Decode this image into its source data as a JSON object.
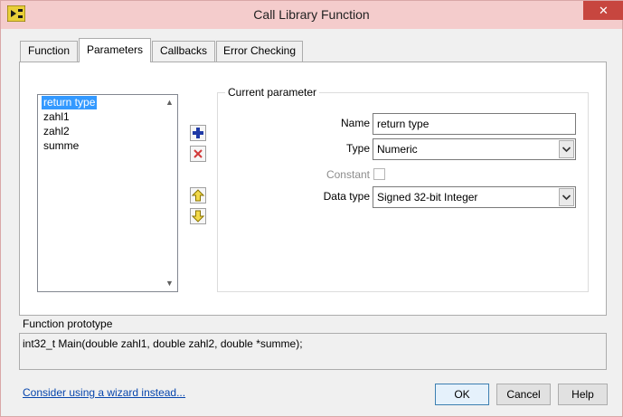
{
  "window": {
    "title": "Call Library Function",
    "close_label": "✕"
  },
  "tabs": [
    {
      "label": "Function",
      "active": false
    },
    {
      "label": "Parameters",
      "active": true
    },
    {
      "label": "Callbacks",
      "active": false
    },
    {
      "label": "Error Checking",
      "active": false
    }
  ],
  "parameters": {
    "list": [
      "return type",
      "zahl1",
      "zahl2",
      "summe"
    ],
    "selected_index": 0,
    "side_buttons": [
      "add-icon",
      "delete-icon",
      "move-up-icon",
      "move-down-icon"
    ]
  },
  "current_parameter": {
    "group_title": "Current parameter",
    "name_label": "Name",
    "name_value": "return type",
    "type_label": "Type",
    "type_value": "Numeric",
    "constant_label": "Constant",
    "constant_checked": false,
    "data_type_label": "Data type",
    "data_type_value": "Signed 32-bit Integer"
  },
  "prototype": {
    "label": "Function prototype",
    "text": "int32_t Main(double zahl1, double zahl2, double *summe);"
  },
  "footer": {
    "wizard_link": "Consider using a wizard instead...",
    "ok_label": "OK",
    "cancel_label": "Cancel",
    "help_label": "Help"
  },
  "colors": {
    "titlebar": "#f4cccc",
    "close": "#c7463f",
    "selection": "#3399ff",
    "add_icon": "#1f3aa6",
    "delete_icon": "#d23a3a",
    "arrow_icon": "#c8a400",
    "link": "#0645ad"
  }
}
